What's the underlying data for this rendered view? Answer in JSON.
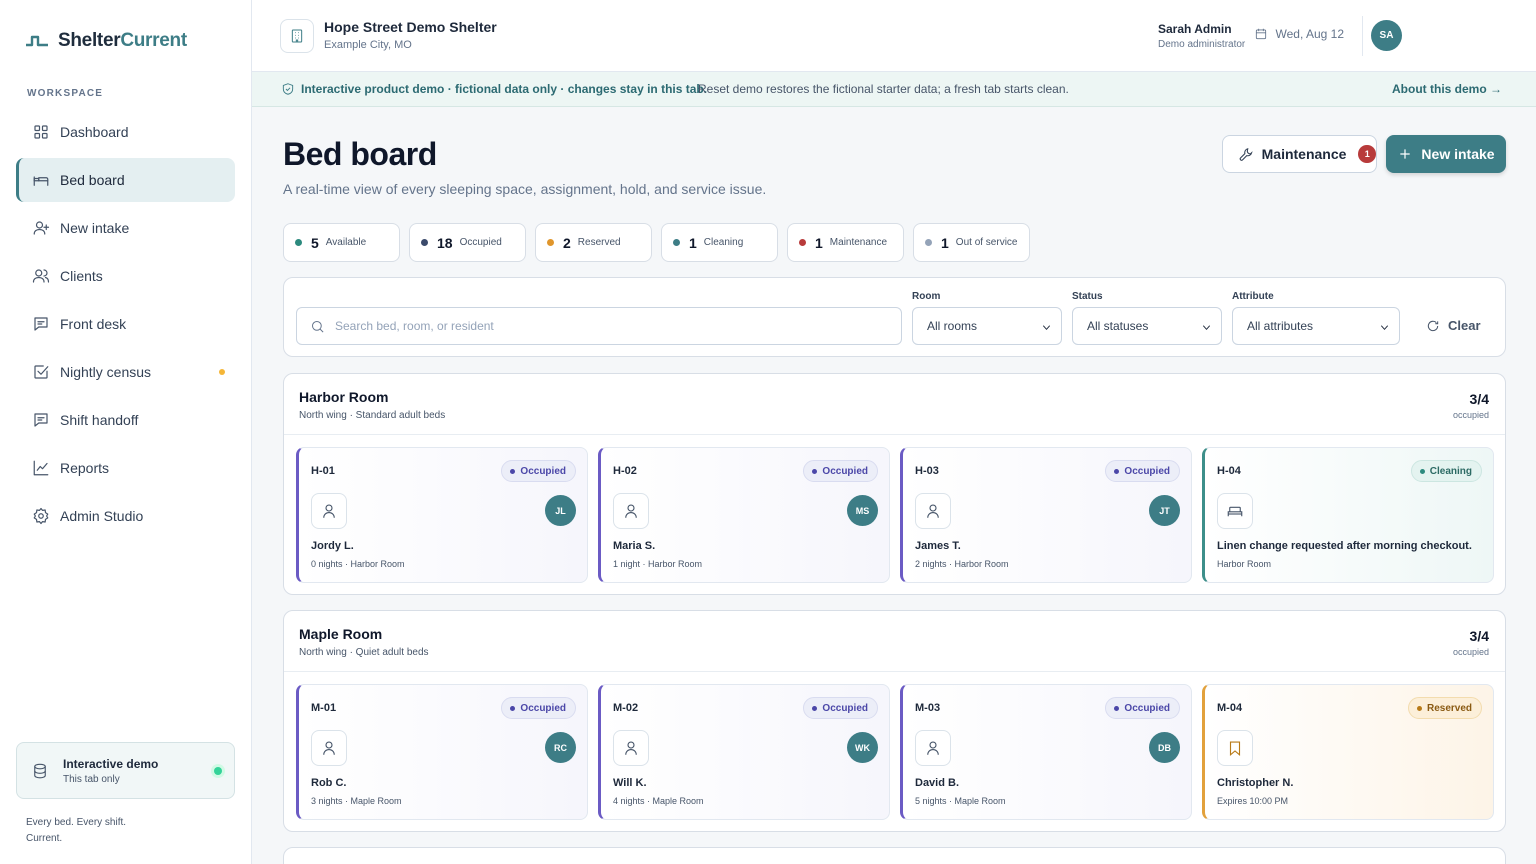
{
  "brand": {
    "name_main": "Shelter",
    "name_accent": "Current"
  },
  "sidebar": {
    "section_label": "WORKSPACE",
    "items": [
      {
        "label": "Dashboard",
        "icon": "dashboard-icon"
      },
      {
        "label": "Bed board",
        "icon": "bed-icon",
        "active": true
      },
      {
        "label": "New intake",
        "icon": "user-plus-icon"
      },
      {
        "label": "Clients",
        "icon": "users-icon"
      },
      {
        "label": "Front desk",
        "icon": "message-icon"
      },
      {
        "label": "Nightly census",
        "icon": "checkbox-icon",
        "has_dot": true
      },
      {
        "label": "Shift handoff",
        "icon": "message-icon"
      },
      {
        "label": "Reports",
        "icon": "chart-line-icon"
      },
      {
        "label": "Admin Studio",
        "icon": "gear-icon"
      }
    ],
    "demo_card": {
      "title": "Interactive demo",
      "subtitle": "This tab only"
    },
    "tagline": "Every bed. Every shift. Current."
  },
  "header": {
    "org_name": "Hope Street Demo Shelter",
    "org_location": "Example City, MO",
    "date": "Wed, Aug 12",
    "user_initials": "SA",
    "user_name": "Sarah Admin",
    "user_role": "Demo administrator"
  },
  "banner": {
    "strong": "Interactive product demo · fictional data only · changes stay in this tab.",
    "text": "Reset demo restores the fictional starter data; a fresh tab starts clean.",
    "link": "About this demo →"
  },
  "page": {
    "title": "Bed board",
    "subtitle": "A real-time view of every sleeping space, assignment, hold, and service issue.",
    "maintenance_label": "Maintenance",
    "maintenance_count": "1",
    "new_intake_label": "New intake"
  },
  "stats": [
    {
      "count": "5",
      "label": "Available",
      "color": "#2c8a7e"
    },
    {
      "count": "18",
      "label": "Occupied",
      "color": "#3b4a6b"
    },
    {
      "count": "2",
      "label": "Reserved",
      "color": "#e0962c"
    },
    {
      "count": "1",
      "label": "Cleaning",
      "color": "#3d7d86"
    },
    {
      "count": "1",
      "label": "Maintenance",
      "color": "#b83b3b"
    },
    {
      "count": "1",
      "label": "Out of service",
      "color": "#94a3b8"
    }
  ],
  "filters": {
    "search_placeholder": "Search bed, room, or resident",
    "room_label": "Room",
    "room_value": "All rooms",
    "status_label": "Status",
    "status_value": "All statuses",
    "attribute_label": "Attribute",
    "attribute_value": "All attributes",
    "clear_label": "Clear"
  },
  "rooms": [
    {
      "name": "Harbor Room",
      "description": "North wing · Standard adult beds",
      "occupancy": "3/4",
      "occupancy_label": "occupied",
      "beds": [
        {
          "id": "H-01",
          "status": "Occupied",
          "person": "Jordy L.",
          "initials": "JL",
          "meta": "0 nights · Harbor Room"
        },
        {
          "id": "H-02",
          "status": "Occupied",
          "person": "Maria S.",
          "initials": "MS",
          "meta": "1 night · Harbor Room"
        },
        {
          "id": "H-03",
          "status": "Occupied",
          "person": "James T.",
          "initials": "JT",
          "meta": "2 nights · Harbor Room"
        },
        {
          "id": "H-04",
          "status": "Cleaning",
          "person": "Linen change requested after morning checkout.",
          "initials": "",
          "meta": "Harbor Room"
        }
      ]
    },
    {
      "name": "Maple Room",
      "description": "North wing · Quiet adult beds",
      "occupancy": "3/4",
      "occupancy_label": "occupied",
      "beds": [
        {
          "id": "M-01",
          "status": "Occupied",
          "person": "Rob C.",
          "initials": "RC",
          "meta": "3 nights · Maple Room"
        },
        {
          "id": "M-02",
          "status": "Occupied",
          "person": "Will K.",
          "initials": "WK",
          "meta": "4 nights · Maple Room"
        },
        {
          "id": "M-03",
          "status": "Occupied",
          "person": "David B.",
          "initials": "DB",
          "meta": "5 nights · Maple Room"
        },
        {
          "id": "M-04",
          "status": "Reserved",
          "person": "Christopher N.",
          "initials": "",
          "meta": "Expires 10:00 PM"
        }
      ]
    }
  ]
}
